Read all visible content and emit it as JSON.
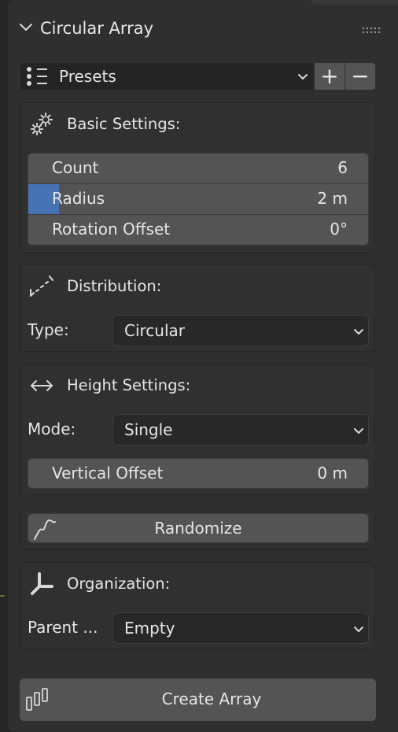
{
  "header": {
    "title": "Circular Array"
  },
  "presets": {
    "label": "Presets",
    "add": "+",
    "remove": "−"
  },
  "basic": {
    "title": "Basic Settings:",
    "fields": [
      {
        "label": "Count",
        "value": "6"
      },
      {
        "label": "Radius",
        "value": "2 m"
      },
      {
        "label": "Rotation Offset",
        "value": "0°"
      }
    ]
  },
  "distribution": {
    "title": "Distribution:",
    "type_label": "Type:",
    "type_value": "Circular"
  },
  "height": {
    "title": "Height Settings:",
    "mode_label": "Mode:",
    "mode_value": "Single",
    "vertical_offset_label": "Vertical Offset",
    "vertical_offset_value": "0 m"
  },
  "randomize": {
    "label": "Randomize"
  },
  "organization": {
    "title": "Organization:",
    "parent_label": "Parent ...",
    "parent_value": "Empty"
  },
  "create": {
    "label": "Create Array"
  },
  "colors": {
    "accent": "#4772b3",
    "field": "#545454",
    "panel": "#303030"
  }
}
